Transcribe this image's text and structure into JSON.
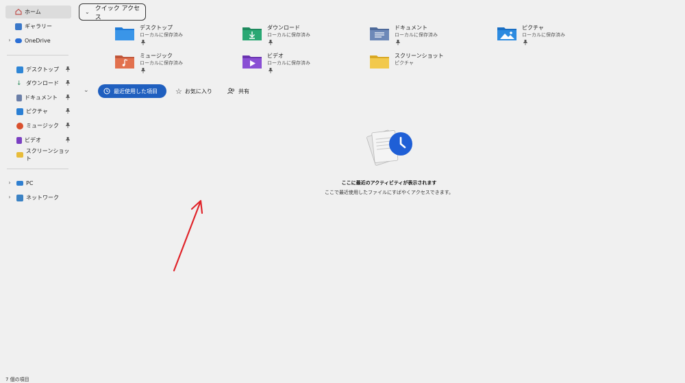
{
  "sidebar": {
    "home": {
      "label": "ホーム"
    },
    "gallery": {
      "label": "ギャラリー"
    },
    "onedrive": {
      "label": "OneDrive"
    },
    "pinned": [
      {
        "label": "デスクトップ"
      },
      {
        "label": "ダウンロード"
      },
      {
        "label": "ドキュメント"
      },
      {
        "label": "ピクチャ"
      },
      {
        "label": "ミュージック"
      },
      {
        "label": "ビデオ"
      },
      {
        "label": "スクリーンショット"
      }
    ],
    "pc": {
      "label": "PC"
    },
    "network": {
      "label": "ネットワーク"
    }
  },
  "quick_access": {
    "header": "クイック アクセス",
    "tiles": [
      {
        "name": "デスクトップ",
        "sub": "ローカルに保存済み",
        "pinned": true
      },
      {
        "name": "ダウンロード",
        "sub": "ローカルに保存済み",
        "pinned": true
      },
      {
        "name": "ドキュメント",
        "sub": "ローカルに保存済み",
        "pinned": true
      },
      {
        "name": "ピクチャ",
        "sub": "ローカルに保存済み",
        "pinned": true
      },
      {
        "name": "ミュージック",
        "sub": "ローカルに保存済み",
        "pinned": true
      },
      {
        "name": "ビデオ",
        "sub": "ローカルに保存済み",
        "pinned": true
      },
      {
        "name": "スクリーンショット",
        "sub": "ピクチャ",
        "pinned": false
      }
    ]
  },
  "tabs": {
    "recent": "最近使用した項目",
    "favorites": "お気に入り",
    "shared": "共有"
  },
  "empty_state": {
    "title": "ここに最近のアクティビティが表示されます",
    "subtitle": "ここで最近使用したファイルにすばやくアクセスできます。"
  },
  "status_bar": {
    "item_count": "7 個の項目"
  },
  "colors": {
    "accent": "#1f5fbf",
    "annotation_arrow": "#e0242a"
  }
}
